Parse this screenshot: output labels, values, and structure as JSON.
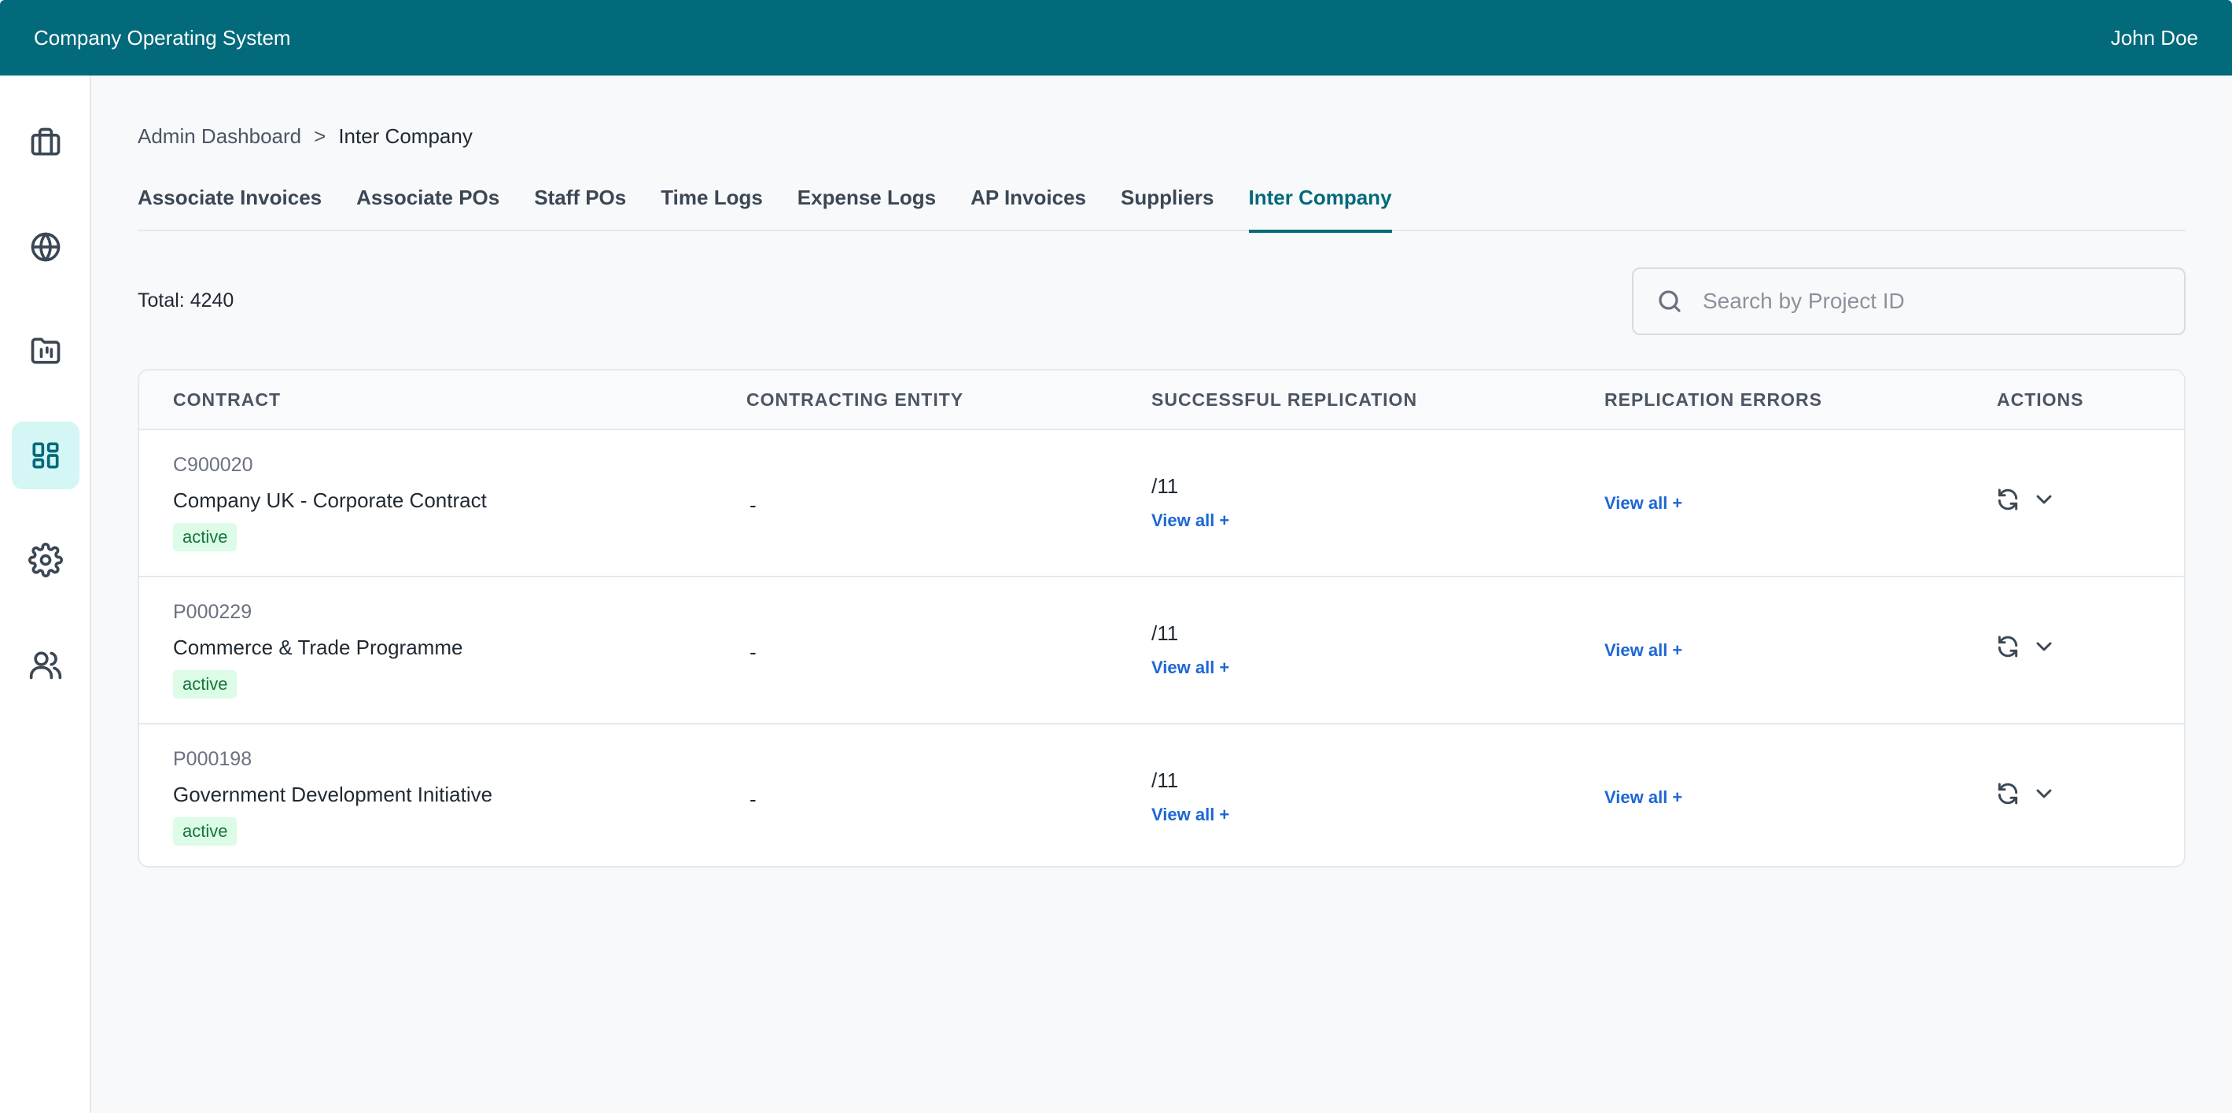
{
  "header": {
    "app_title": "Company Operating System",
    "user_name": "John Doe"
  },
  "sidebar": {
    "items": [
      {
        "icon": "briefcase-icon"
      },
      {
        "icon": "globe-icon"
      },
      {
        "icon": "folder-chart-icon"
      },
      {
        "icon": "dashboard-icon",
        "active": true
      },
      {
        "icon": "gear-icon"
      },
      {
        "icon": "users-icon"
      }
    ]
  },
  "breadcrumb": {
    "parent": "Admin Dashboard",
    "separator": ">",
    "current": "Inter Company"
  },
  "tabs": [
    {
      "label": "Associate Invoices"
    },
    {
      "label": "Associate POs"
    },
    {
      "label": "Staff POs"
    },
    {
      "label": "Time Logs"
    },
    {
      "label": "Expense Logs"
    },
    {
      "label": "AP Invoices"
    },
    {
      "label": "Suppliers"
    },
    {
      "label": "Inter Company",
      "active": true
    }
  ],
  "summary": {
    "total_label": "Total: 4240"
  },
  "search": {
    "placeholder": "Search by Project ID",
    "value": ""
  },
  "table": {
    "columns": [
      "CONTRACT",
      "CONTRACTING ENTITY",
      "SUCCESSFUL REPLICATION",
      "REPLICATION ERRORS",
      "ACTIONS"
    ],
    "rows": [
      {
        "id": "C900020",
        "name": "Company UK - Corporate Contract",
        "status": "active",
        "entity": "-",
        "replication": "/11",
        "replication_link": "View all +",
        "errors_link": "View all +"
      },
      {
        "id": "P000229",
        "name": "Commerce & Trade Programme",
        "status": "active",
        "entity": "-",
        "replication": "/11",
        "replication_link": "View all +",
        "errors_link": "View all +"
      },
      {
        "id": "P000198",
        "name": "Government Development Initiative",
        "status": "active",
        "entity": "-",
        "replication": "/11",
        "replication_link": "View all +",
        "errors_link": "View all +"
      }
    ]
  },
  "colors": {
    "brand": "#026a7a",
    "link": "#1d67d4",
    "badge_bg": "#dcfce7",
    "badge_text": "#16743c"
  }
}
